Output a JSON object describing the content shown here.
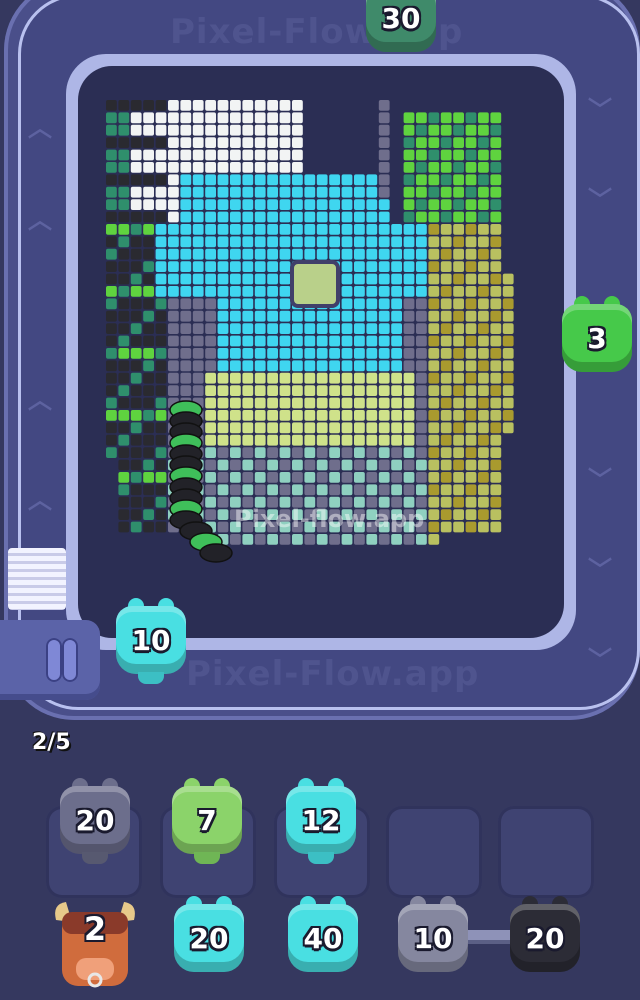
{
  "game": {
    "watermark_top": "Pixel-Flow.app",
    "watermark_bottom": "Pixel-Flow.app",
    "watermark_center": "Pixel-flow.app",
    "queue_progress": "2/5"
  },
  "track_shooters": [
    {
      "id": "top",
      "value": "30",
      "color": "#3f8a6a"
    },
    {
      "id": "right",
      "value": "3",
      "color": "#46c94a"
    },
    {
      "id": "dock",
      "value": "10",
      "color": "#49dfe2"
    }
  ],
  "slots_row1": [
    {
      "value": "20",
      "color": "#6c6e8c"
    },
    {
      "value": "7",
      "color": "#8bd36a"
    },
    {
      "value": "12",
      "color": "#49dfe2"
    },
    {
      "value": "",
      "color": ""
    },
    {
      "value": "",
      "color": ""
    }
  ],
  "slots_row2": [
    {
      "value": "2",
      "color": "#d06c3d",
      "special": "bull"
    },
    {
      "value": "20",
      "color": "#49dfe2"
    },
    {
      "value": "40",
      "color": "#49dfe2"
    },
    {
      "value": "10",
      "color": "#85879f"
    },
    {
      "value": "20",
      "color": "#2c2c36"
    }
  ],
  "palette": {
    "cyan": "#3fd6f0",
    "white": "#f2f4f4",
    "teal": "#2f8f6c",
    "green": "#5fd33f",
    "olive": "#b9c060",
    "lime": "#cfe28a",
    "mustard": "#a99a2e",
    "gray": "#6f6e8c",
    "dark": "#2a2a30",
    "seafoam": "#8fd0c0"
  }
}
